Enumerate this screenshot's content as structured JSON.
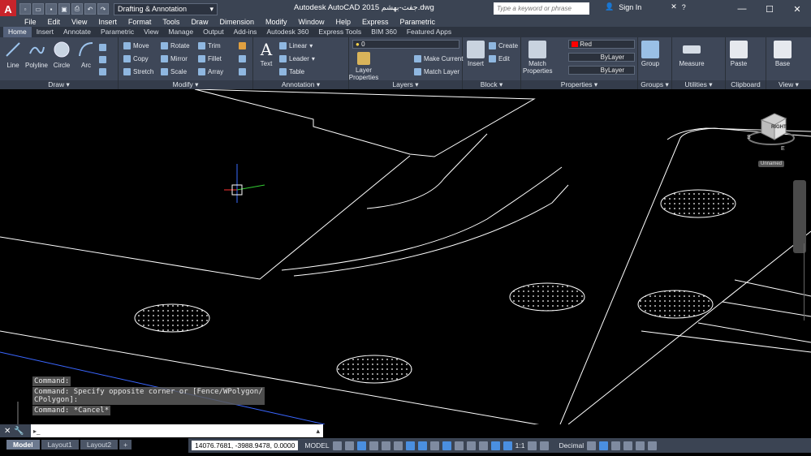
{
  "title_bar": {
    "title": "Autodesk AutoCAD 2015  جفت-بهشم.dwg",
    "workspace": "Drafting & Annotation",
    "search_placeholder": "Type a keyword or phrase",
    "sign_in": "Sign In"
  },
  "menu": [
    "File",
    "Edit",
    "View",
    "Insert",
    "Format",
    "Tools",
    "Draw",
    "Dimension",
    "Modify",
    "Window",
    "Help",
    "Express",
    "Parametric"
  ],
  "ribbon_tabs": [
    "Home",
    "Insert",
    "Annotate",
    "Parametric",
    "View",
    "Manage",
    "Output",
    "Add-ins",
    "Autodesk 360",
    "Express Tools",
    "BIM 360",
    "Featured Apps"
  ],
  "panels": {
    "draw": {
      "label": "Draw",
      "buttons": [
        "Line",
        "Polyline",
        "Circle",
        "Arc"
      ]
    },
    "modify": {
      "label": "Modify",
      "items": [
        "Move",
        "Rotate",
        "Trim",
        "Copy",
        "Mirror",
        "Fillet",
        "Stretch",
        "Scale",
        "Array"
      ]
    },
    "annotation": {
      "label": "Annotation",
      "text": "Text",
      "items": [
        "Linear",
        "Leader",
        "Table"
      ]
    },
    "layers": {
      "label": "Layers",
      "layer_properties": "Layer Properties",
      "current_layer": "0",
      "items": [
        "Make Current",
        "Match Layer"
      ]
    },
    "block": {
      "label": "Block",
      "insert": "Insert",
      "items": [
        "Create",
        "Edit"
      ]
    },
    "properties": {
      "label": "Properties",
      "match": "Match Properties",
      "color": "Red",
      "linetype": "ByLayer",
      "lineweight": "ByLayer"
    },
    "groups": {
      "label": "Groups",
      "group": "Group"
    },
    "utilities": {
      "label": "Utilities",
      "measure": "Measure"
    },
    "clipboard": {
      "label": "Clipboard",
      "paste": "Paste"
    },
    "view": {
      "label": "View",
      "base": "Base"
    }
  },
  "viewcube": {
    "face": "RIGHT",
    "dirs": [
      "S",
      "E"
    ],
    "wcs": "Unnamed"
  },
  "command_history": [
    "Command:",
    "Command: Specify opposite corner or [Fence/WPolygon/\nCPolygon]:",
    "Command: *Cancel*"
  ],
  "layout_tabs": [
    "Model",
    "Layout1",
    "Layout2"
  ],
  "status": {
    "coords": "14076.7681, -3988.9478, 0.0000",
    "space": "MODEL",
    "scale": "1:1",
    "units": "Decimal"
  },
  "colors": {
    "accent": "#c8242b",
    "chrome": "#3b4453",
    "ribbon": "#3e4758"
  }
}
